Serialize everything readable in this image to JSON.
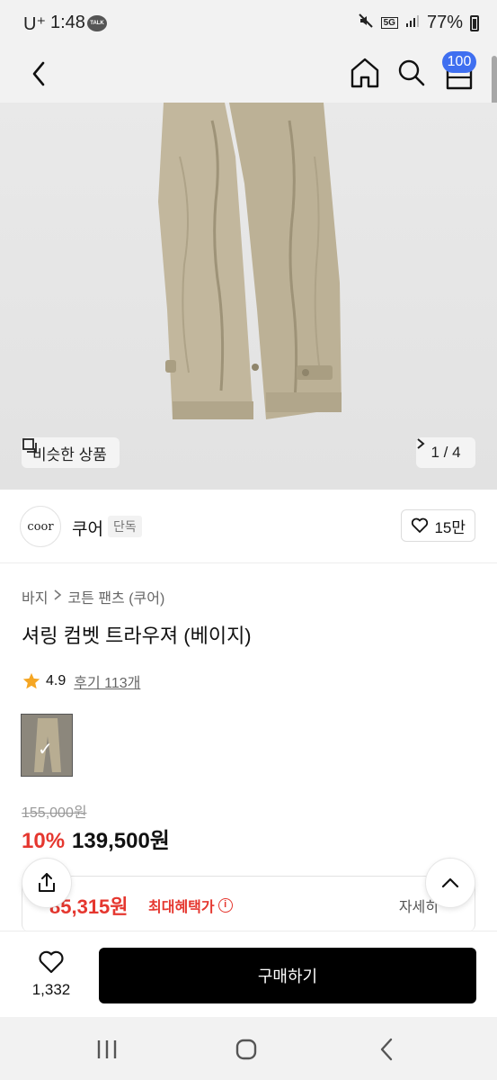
{
  "status_bar": {
    "carrier": "U⁺",
    "time": "1:48",
    "talk_badge": "TALK",
    "network": "5G",
    "battery": "77%"
  },
  "top_nav": {
    "cart_count": "100"
  },
  "gallery": {
    "similar_label": "비슷한 상품",
    "pager_text": "1 / 4"
  },
  "brand": {
    "logo_text": "coor",
    "name": "쿠어",
    "tag": "단독",
    "likes": "15만"
  },
  "product": {
    "breadcrumb": [
      "바지",
      "코튼 팬츠 (쿠어)"
    ],
    "title": "셔링 컴벳 트라우져 (베이지)",
    "rating": "4.9",
    "reviews_label": "후기 113개",
    "original_price": "155,000원",
    "discount": "10%",
    "price": "139,500원"
  },
  "benefit": {
    "amount": "85,315원",
    "label": "최대혜택가",
    "info_glyph": "i",
    "detail": "자세히"
  },
  "action_bar": {
    "wish_count": "1,332",
    "buy_label": "구매하기"
  },
  "colors": {
    "accent_red": "#e5372f",
    "badge_blue": "#3f6ff0",
    "buy_button": "#000000"
  }
}
